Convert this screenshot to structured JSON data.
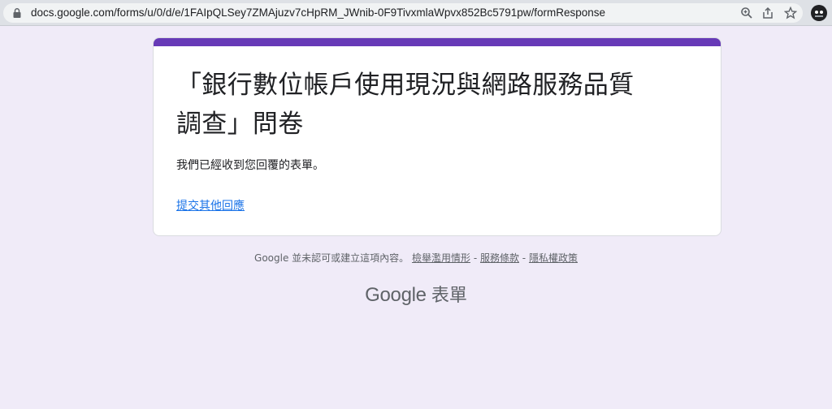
{
  "browser": {
    "url": "docs.google.com/forms/u/0/d/e/1FAIpQLSey7ZMAjuzv7cHpRM_JWnib-0F9TivxmlaWpvx852Bc5791pw/formResponse",
    "icons": [
      "lock-icon",
      "zoom-icon",
      "share-icon",
      "star-icon",
      "profile-icon"
    ]
  },
  "form": {
    "title_line1": "「銀行數位帳戶使用現況與網路服務品質",
    "title_line2": "調查」問卷",
    "confirmation": "我們已經收到您回覆的表單。",
    "resubmit_link": "提交其他回應",
    "accent_color": "#673ab7"
  },
  "footer": {
    "disclaimer": "Google 並未認可或建立這項內容。",
    "report_link": "檢舉濫用情形",
    "sep1": " - ",
    "terms_link": "服務條款",
    "sep2": " - ",
    "privacy_link": "隱私權政策",
    "brand_google": "Google",
    "brand_forms": "表單"
  },
  "page": {
    "background": "#f0ebf8"
  }
}
